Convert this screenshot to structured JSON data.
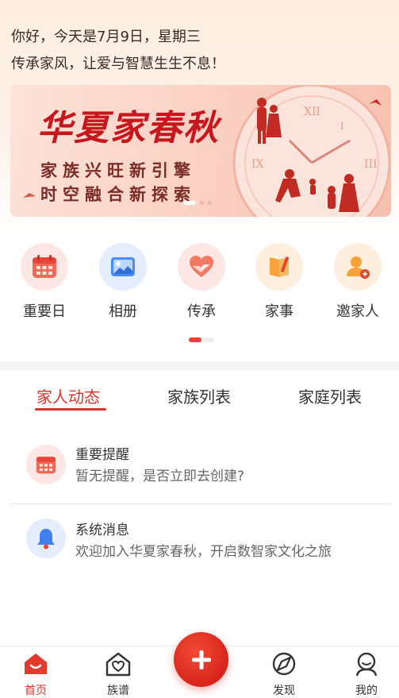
{
  "greeting": {
    "line1": "你好，今天是7月9日，星期三",
    "line2": "传承家风，让爱与智慧生生不息！"
  },
  "banner": {
    "title": "华夏家春秋",
    "subtitle1": "家族兴旺新引擎",
    "subtitle2": "时空融合新探索",
    "slides_total": 3,
    "active_slide": 1
  },
  "quick_actions": [
    {
      "label": "重要日",
      "icon": "calendar-icon"
    },
    {
      "label": "相册",
      "icon": "photo-album-icon"
    },
    {
      "label": "传承",
      "icon": "heart-hands-icon"
    },
    {
      "label": "家事",
      "icon": "book-pencil-icon"
    },
    {
      "label": "邀家人",
      "icon": "invite-user-icon"
    }
  ],
  "tabs": [
    {
      "label": "家人动态",
      "active": true
    },
    {
      "label": "家族列表",
      "active": false
    },
    {
      "label": "家庭列表",
      "active": false
    }
  ],
  "messages": [
    {
      "title": "重要提醒",
      "text": "暂无提醒，是否立即去创建?",
      "icon": "calendar-icon"
    },
    {
      "title": "系统消息",
      "text": "欢迎加入华夏家春秋，开启数智家文化之旅",
      "icon": "bell-icon"
    }
  ],
  "bottom_nav": [
    {
      "label": "首页",
      "icon": "home-icon",
      "active": true
    },
    {
      "label": "族谱",
      "icon": "family-tree-icon",
      "active": false
    },
    {
      "label": "发现",
      "icon": "discover-icon",
      "active": false
    },
    {
      "label": "我的",
      "icon": "profile-icon",
      "active": false
    }
  ],
  "fab": {
    "icon": "plus-icon"
  },
  "colors": {
    "accent": "#d9352e",
    "brand_red": "#c8161d",
    "header_bg": "#fdeee0"
  }
}
